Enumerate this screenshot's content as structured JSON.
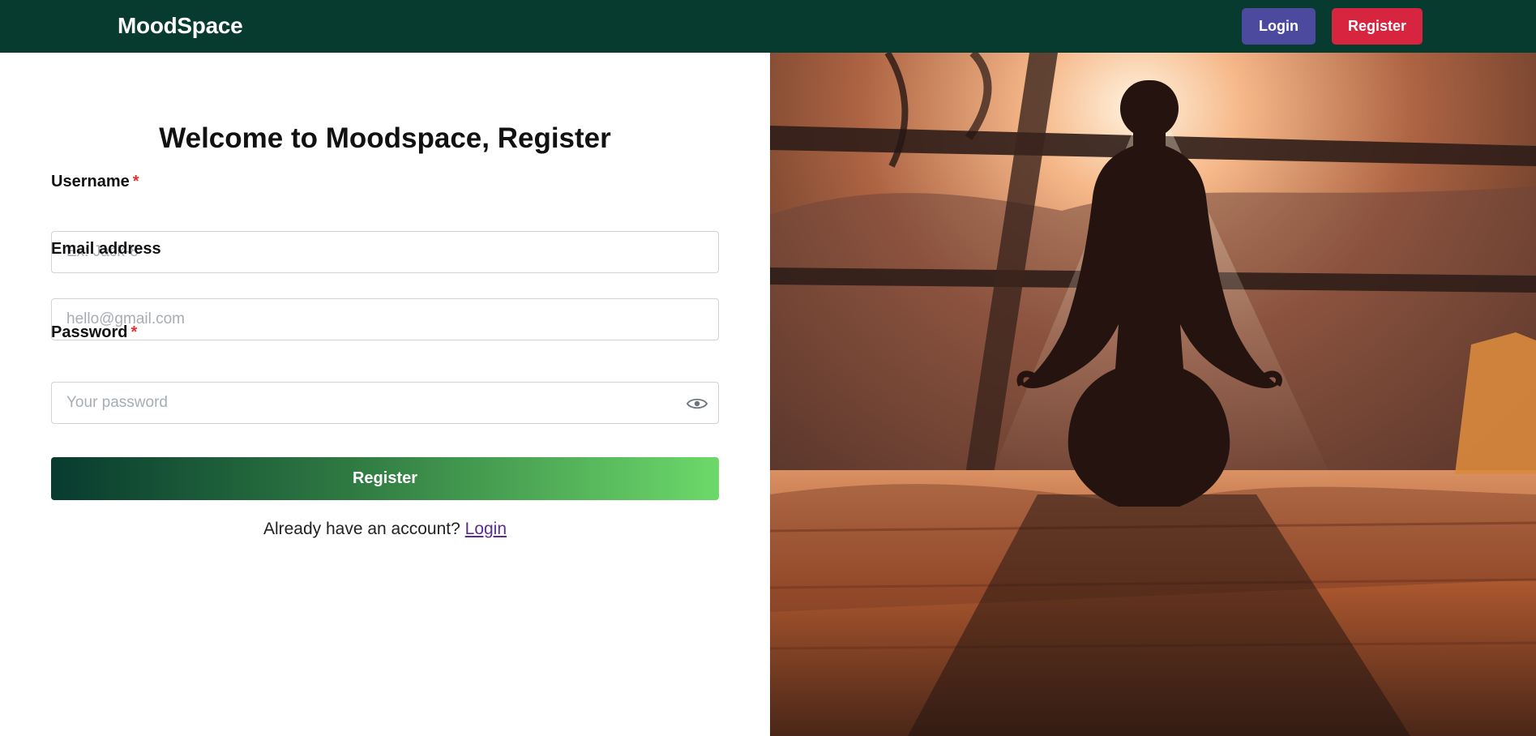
{
  "nav": {
    "brand": "MoodSpace",
    "login_label": "Login",
    "register_label": "Register"
  },
  "form": {
    "title": "Welcome to Moodspace, Register",
    "username_label": "Username",
    "username_required_mark": "*",
    "username_placeholder": "Ex: Jack-8",
    "email_label": "Email address",
    "email_placeholder": "hello@gmail.com",
    "password_label": "Password",
    "password_required_mark": "*",
    "password_placeholder": "Your password",
    "password_toggle_icon": "eye-icon",
    "submit_label": "Register",
    "account_prompt": "Already have an account?",
    "account_link": "Login"
  },
  "hero": {
    "image_subject": "person meditating at sunset"
  },
  "colors": {
    "navbar": "#073b2f",
    "login_button": "#4b4a9e",
    "register_button": "#d8253f",
    "required": "#e03131",
    "gradient_start": "#073b2f",
    "gradient_end": "#6dd96a",
    "link": "#5b2d91"
  }
}
